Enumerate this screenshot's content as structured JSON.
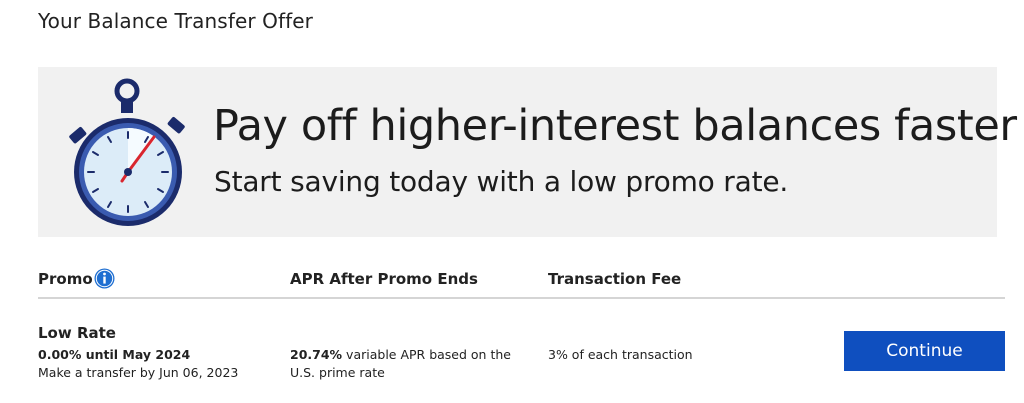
{
  "page": {
    "title": "Your Balance Transfer Offer"
  },
  "banner": {
    "headline": "Pay off higher-interest balances faster",
    "subheadline": "Start saving today with a low promo rate.",
    "icon": "stopwatch-icon"
  },
  "table": {
    "headers": {
      "promo": "Promo",
      "apr": "APR After Promo Ends",
      "fee": "Transaction Fee"
    },
    "info_icon": "info-icon",
    "row": {
      "title": "Low Rate",
      "promo_rate": "0.00% until May 2024",
      "promo_deadline": "Make a transfer by Jun 06, 2023",
      "apr_value": "20.74%",
      "apr_text_line1": " variable APR based on the",
      "apr_text_line2": "U.S. prime rate",
      "fee": "3% of each transaction"
    }
  },
  "actions": {
    "continue_label": "Continue"
  },
  "colors": {
    "button_blue": "#0f4fbf",
    "banner_bg": "#f1f1f1",
    "stopwatch_navy": "#1b2b6b",
    "info_blue": "#1f6fd1"
  }
}
